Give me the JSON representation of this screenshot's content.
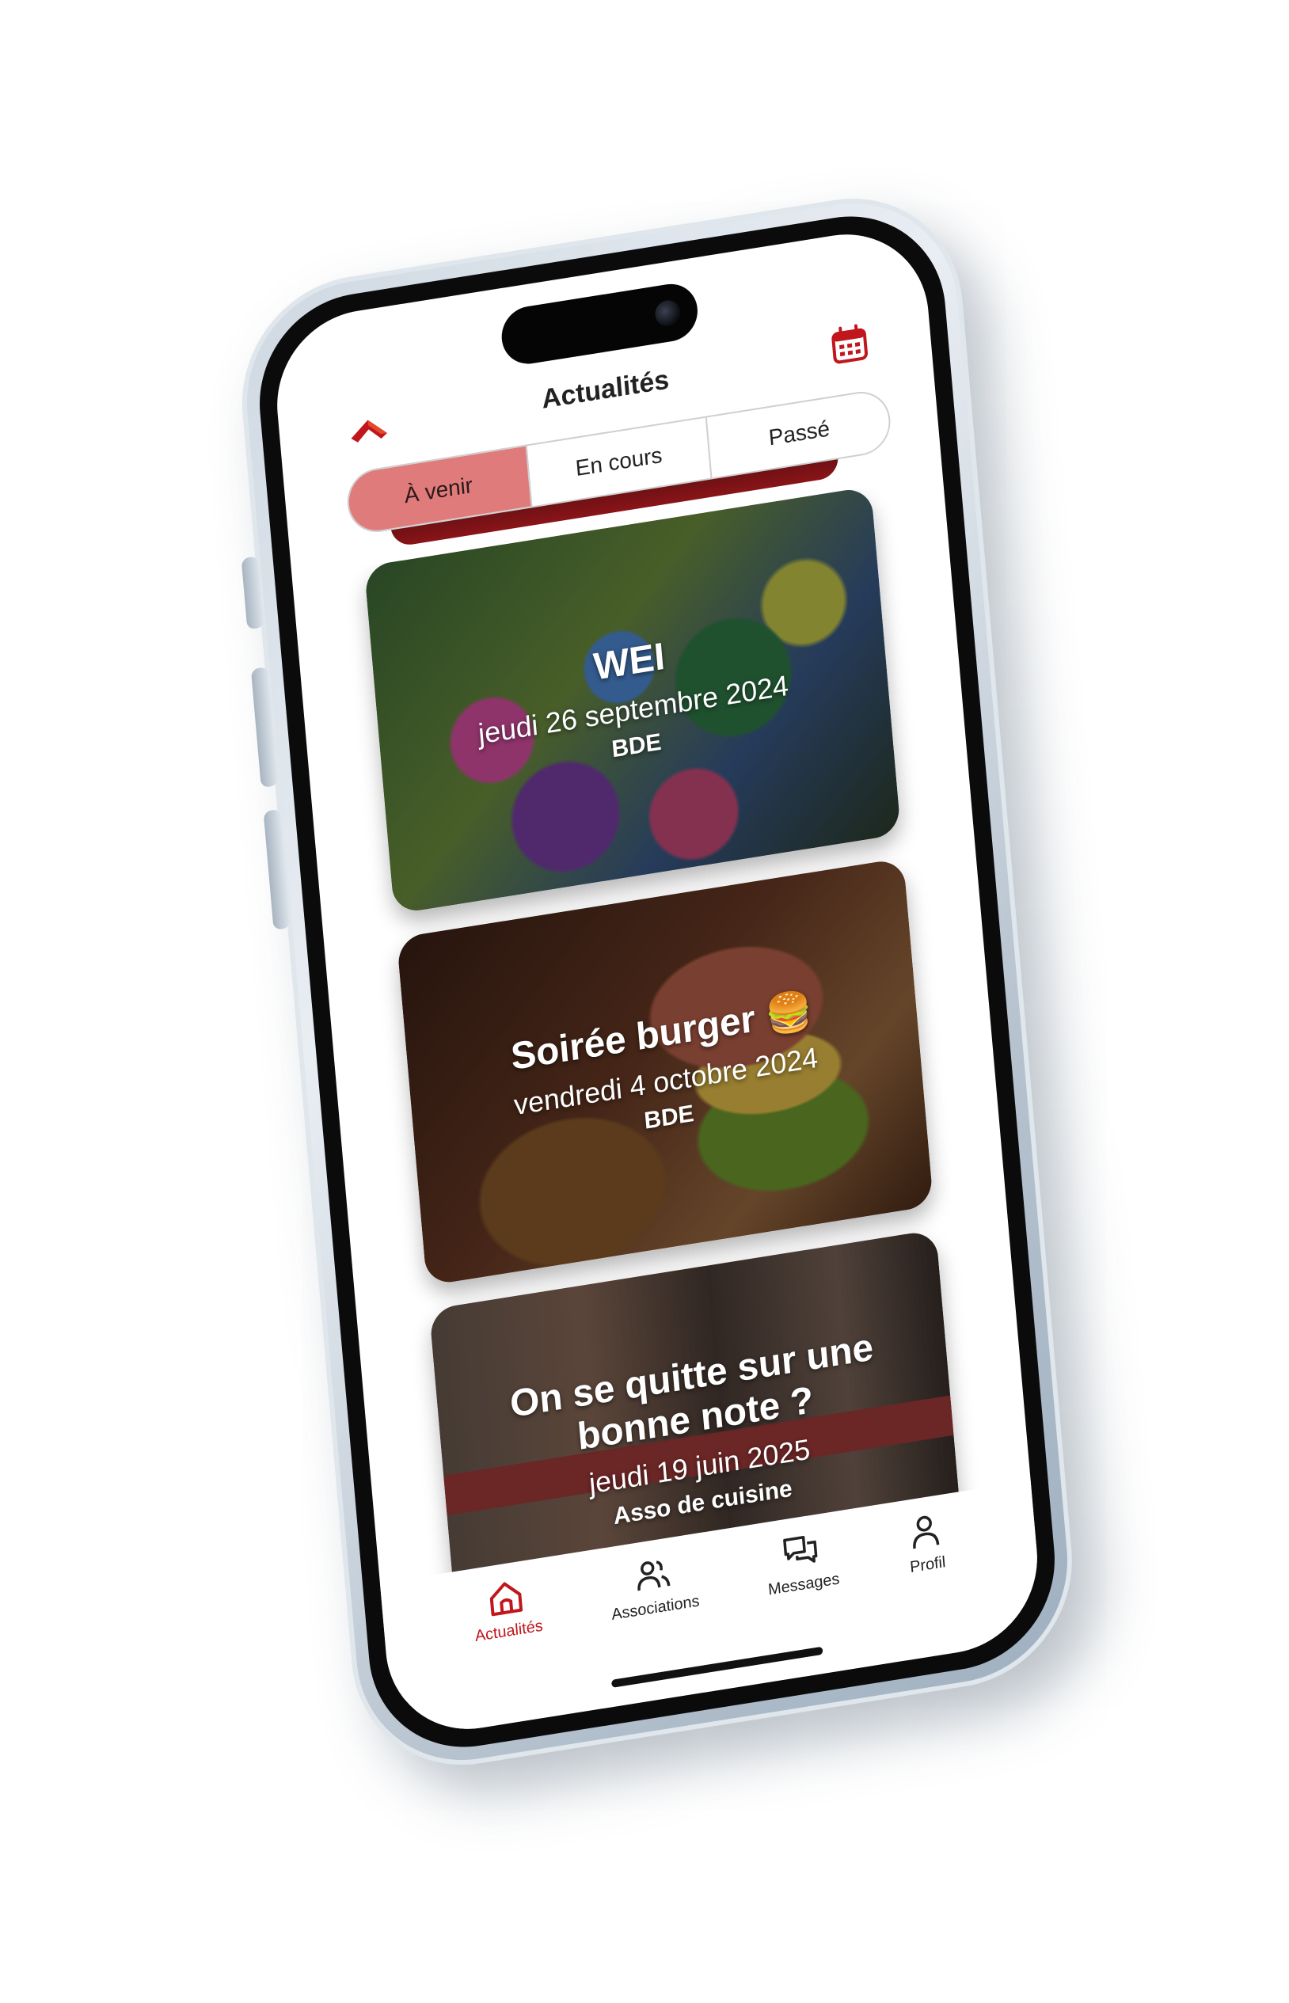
{
  "header": {
    "title": "Actualités"
  },
  "filters": {
    "tabs": [
      {
        "label": "À venir",
        "active": true
      },
      {
        "label": "En cours",
        "active": false
      },
      {
        "label": "Passé",
        "active": false
      }
    ]
  },
  "events": [
    {
      "title": "WEI",
      "date": "jeudi 26 septembre 2024",
      "organizer": "BDE"
    },
    {
      "title": "Soirée burger 🍔",
      "date": "vendredi 4 octobre 2024",
      "organizer": "BDE"
    },
    {
      "title": "On se quitte sur une bonne note ?",
      "date": "jeudi 19 juin 2025",
      "organizer": "Asso de cuisine"
    }
  ],
  "tabbar": {
    "items": [
      {
        "label": "Actualités",
        "icon": "home-icon",
        "active": true
      },
      {
        "label": "Associations",
        "icon": "users-icon",
        "active": false
      },
      {
        "label": "Messages",
        "icon": "chat-icon",
        "active": false
      },
      {
        "label": "Profil",
        "icon": "user-icon",
        "active": false
      }
    ]
  },
  "colors": {
    "accent": "#c0161c",
    "active_filter": "#e07b7b"
  }
}
